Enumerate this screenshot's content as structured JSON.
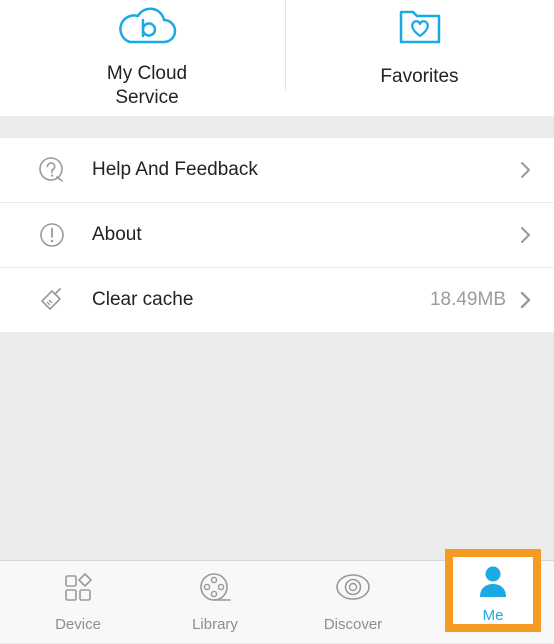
{
  "shortcuts": {
    "cloud": {
      "label": "My Cloud\nService",
      "icon": "cloud-b-icon"
    },
    "favorites": {
      "label": "Favorites",
      "icon": "heart-folder-icon"
    }
  },
  "menu": {
    "items": [
      {
        "label": "Help And Feedback",
        "icon": "question-circle-icon",
        "value": ""
      },
      {
        "label": "About",
        "icon": "exclamation-circle-icon",
        "value": ""
      },
      {
        "label": "Clear cache",
        "icon": "broom-icon",
        "value": "18.49MB"
      }
    ]
  },
  "tabbar": {
    "tabs": [
      {
        "label": "Device",
        "icon": "device-grid-icon",
        "active": false
      },
      {
        "label": "Library",
        "icon": "film-reel-icon",
        "active": false
      },
      {
        "label": "Discover",
        "icon": "eye-lens-icon",
        "active": false
      },
      {
        "label": "Me",
        "icon": "person-icon",
        "active": true
      }
    ]
  },
  "colors": {
    "accent": "#1aa9e3",
    "highlight": "#f59a23",
    "background": "#ebebeb"
  }
}
